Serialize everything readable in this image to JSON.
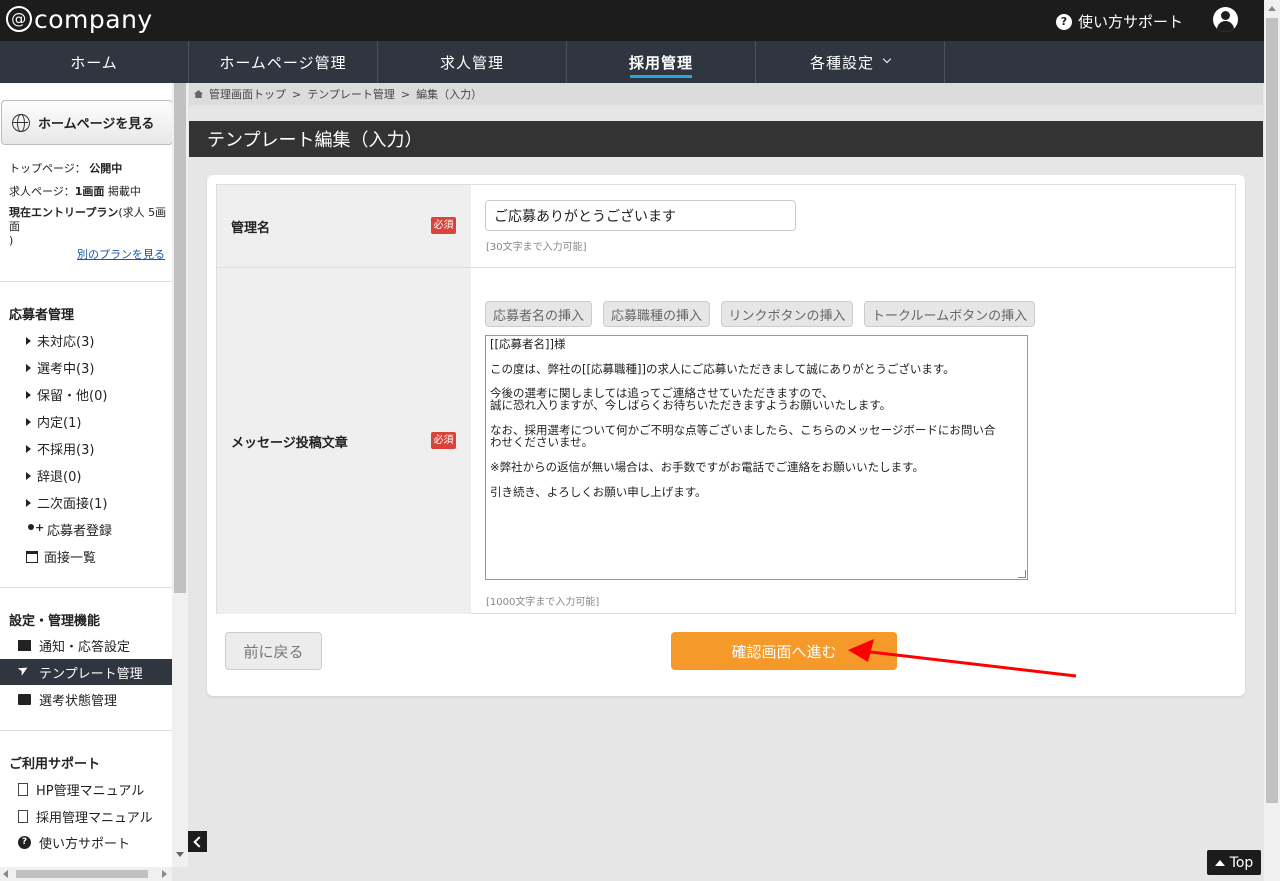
{
  "header": {
    "logo": "company",
    "support": "使い方サポート"
  },
  "nav": [
    {
      "label": "ホーム"
    },
    {
      "label": "ホームページ管理"
    },
    {
      "label": "求人管理"
    },
    {
      "label": "採用管理"
    },
    {
      "label": "各種設定"
    }
  ],
  "sidebar": {
    "view_hp": "ホームページを見る",
    "status1_label": "トップページ：",
    "status1_value": "公開中",
    "status2_label": "求人ページ：",
    "status2_value": "1画面",
    "status2_suffix": " 掲載中",
    "status3_label": "現在エントリープラン",
    "status3_value": "(求人 5画面",
    "status3_close": ")",
    "other_plan": "別のプランを見る",
    "applicant_heading": "応募者管理",
    "applicants": [
      "未対応(3)",
      "選考中(3)",
      "保留・他(0)",
      "内定(1)",
      "不採用(3)",
      "辞退(0)",
      "二次面接(1)"
    ],
    "register": "応募者登録",
    "interviews": "面接一覧",
    "settings_heading": "設定・管理機能",
    "notify": "通知・応答設定",
    "template": "テンプレート管理",
    "selection_status": "選考状態管理",
    "support_heading": "ご利用サポート",
    "hp_manual": "HP管理マニュアル",
    "recruit_manual": "採用管理マニュアル",
    "howto": "使い方サポート"
  },
  "breadcrumb": {
    "home": "管理画面トップ",
    "sep": ">",
    "template": "テンプレート管理",
    "current": "編集（入力）"
  },
  "page_title": "テンプレート編集（入力）",
  "form": {
    "name_label": "管理名",
    "required": "必須",
    "name_value": "ご応募ありがとうございます",
    "name_hint": "[30文字まで入力可能]",
    "message_label": "メッセージ投稿文章",
    "insert_buttons": [
      "応募者名の挿入",
      "応募職種の挿入",
      "リンクボタンの挿入",
      "トークルームボタンの挿入"
    ],
    "message_value": "[[応募者名]]様\n\nこの度は、弊社の[[応募職種]]の求人にご応募いただきまして誠にありがとうございます。\n\n今後の選考に関しましては追ってご連絡させていただきますので、\n誠に恐れ入りますが、今しばらくお待ちいただきますようお願いいたします。\n\nなお、採用選考について何かご不明な点等ございましたら、こちらのメッセージボードにお問い合\nわせくださいませ。\n\n※弊社からの返信が無い場合は、お手数ですがお電話でご連絡をお願いいたします。\n\n引き続き、よろしくお願い申し上げます。",
    "message_hint": "[1000文字まで入力可能]"
  },
  "buttons": {
    "back": "前に戻る",
    "confirm": "確認画面へ進む"
  },
  "top_button": "Top",
  "colors": {
    "accent": "#f5992b",
    "nav_bg": "#2f3640",
    "active_underline": "#2aa3e0",
    "required": "#d9443a",
    "annotation_arrow": "#ff0000"
  }
}
